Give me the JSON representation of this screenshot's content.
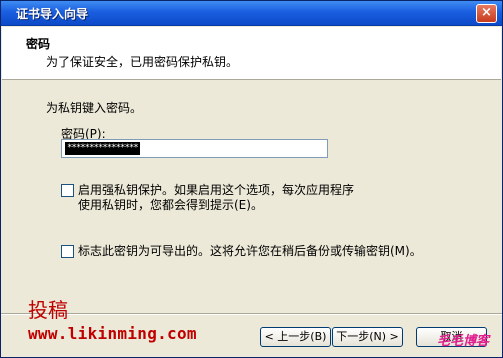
{
  "window": {
    "title": "证书导入向导",
    "close_glyph": "×"
  },
  "header": {
    "title": "密码",
    "subtitle": "为了保证安全，已用密码保护私钥。"
  },
  "content": {
    "prompt": "为私钥键入密码。",
    "password_label": "密码(P):",
    "password_value": "****************"
  },
  "options": [
    {
      "line1": "启用强私钥保护。如果启用这个选项，每次应用程序",
      "line2": "使用私钥时，您都会得到提示(E)。",
      "checked": false
    },
    {
      "line1": "标志此密钥为可导出的。这将允许您在稍后备份或传输密钥(M)。",
      "checked": false
    }
  ],
  "buttons": {
    "back": "< 上一步(B)",
    "next": "下一步(N) >",
    "cancel": "取消"
  },
  "watermark": {
    "label": "投稿",
    "url": "www.likinming.com",
    "logo_text": "毛毛博客"
  },
  "colors": {
    "titlebar": "#0b49c8",
    "dialog_bg": "#ece9d8",
    "watermark": "#c00000"
  }
}
